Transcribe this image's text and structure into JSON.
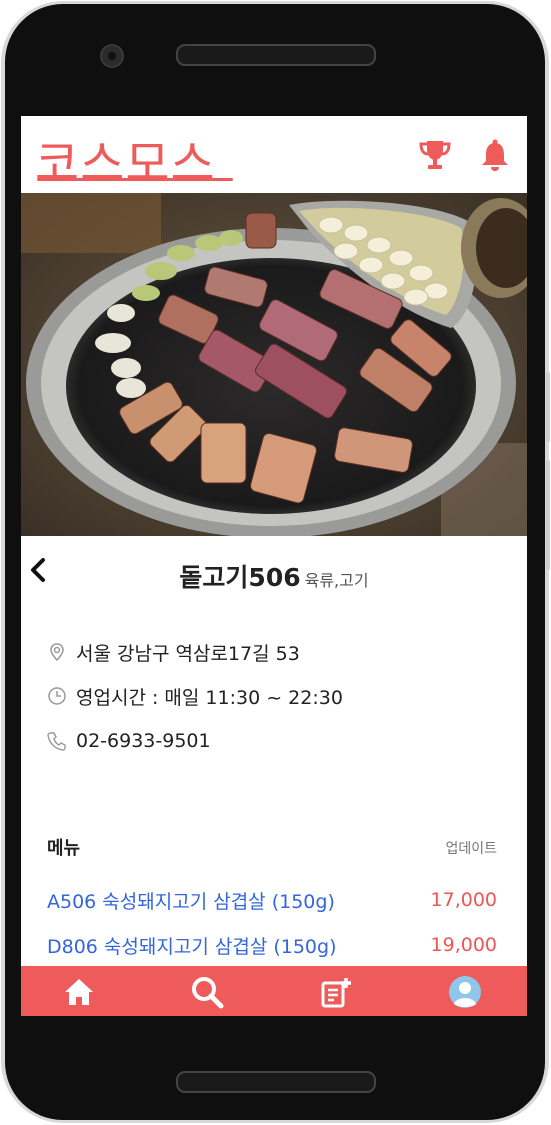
{
  "app": {
    "logo": "코스모스"
  },
  "header": {
    "icons": [
      "trophy-icon",
      "bell-icon"
    ]
  },
  "restaurant": {
    "name": "돝고기506",
    "category": "육류,고기",
    "address": "서울 강남구 역삼로17길 53",
    "hours": "영업시간 : 매일 11:30 ~ 22:30",
    "phone": "02-6933-9501"
  },
  "menu": {
    "title": "메뉴",
    "update_label": "업데이트",
    "items": [
      {
        "name": "A506 숙성돼지고기 삼겹살 (150g)",
        "price": "17,000"
      },
      {
        "name": "D806 숙성돼지고기 삼겹살 (150g)",
        "price": "19,000"
      }
    ]
  },
  "bottom_nav": {
    "items": [
      "home-icon",
      "search-icon",
      "write-icon",
      "profile-icon"
    ]
  },
  "colors": {
    "accent": "#ef5a5a",
    "link": "#3366dd",
    "price": "#ee5555"
  }
}
